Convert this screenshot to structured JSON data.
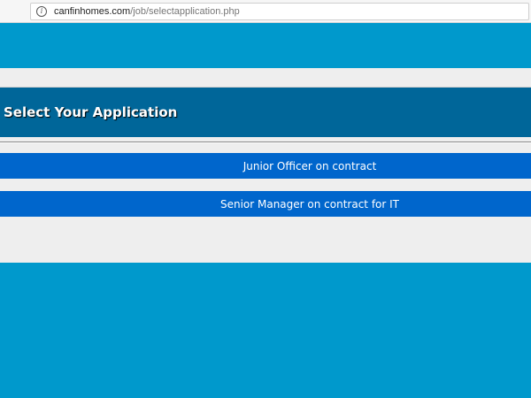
{
  "browser": {
    "url_host": "canfinhomes.com",
    "url_path": "/job/selectapplication.php",
    "info_icon": "info-icon"
  },
  "page": {
    "title": "Select Your Application",
    "applications": [
      {
        "label": "Junior Officer on contract"
      },
      {
        "label": "Senior Manager on contract for IT"
      }
    ]
  },
  "colors": {
    "outer_background": "#0099cc",
    "content_background": "#eeeeee",
    "header_background": "#006699",
    "button_background": "#0066cc",
    "text_light": "#ffffff"
  }
}
